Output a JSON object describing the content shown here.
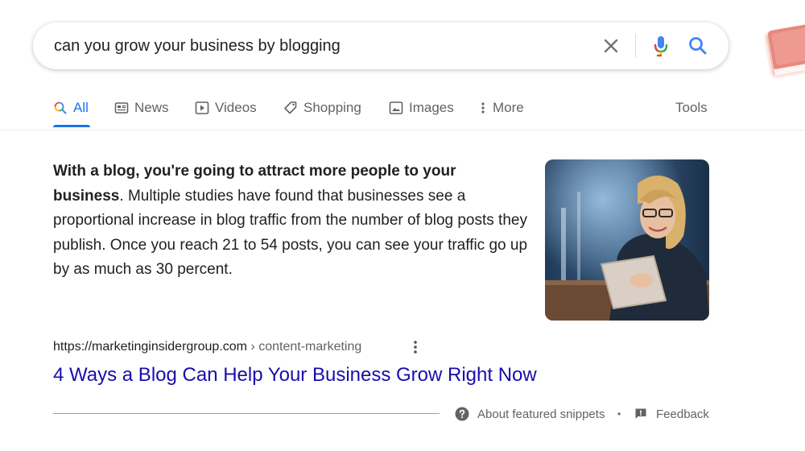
{
  "search": {
    "query": "can you grow your business by blogging"
  },
  "tabs": {
    "items": [
      {
        "label": "All",
        "icon": "search-icon"
      },
      {
        "label": "News",
        "icon": "news-icon"
      },
      {
        "label": "Videos",
        "icon": "video-icon"
      },
      {
        "label": "Shopping",
        "icon": "tag-icon"
      },
      {
        "label": "Images",
        "icon": "image-icon"
      },
      {
        "label": "More",
        "icon": "more-vert-icon"
      }
    ],
    "active": "All",
    "tools_label": "Tools"
  },
  "snippet": {
    "bold_text": "With a blog, you're going to attract more people to your business",
    "after_bold": ".",
    "body_text": "Multiple studies have found that businesses see a proportional increase in blog traffic from the number of blog posts they publish. Once you reach 21 to 54 posts, you can see your traffic go up by as much as 30 percent."
  },
  "result": {
    "url": "https://marketinginsidergroup.com",
    "breadcrumb": " › content-marketing",
    "title": "4 Ways a Blog Can Help Your Business Grow Right Now"
  },
  "footer": {
    "about_label": "About featured snippets",
    "separator": "•",
    "feedback_label": "Feedback"
  },
  "colors": {
    "accent": "#1a73e8",
    "link": "#1a0dab",
    "text": "#202124",
    "secondary": "#5f6368"
  }
}
